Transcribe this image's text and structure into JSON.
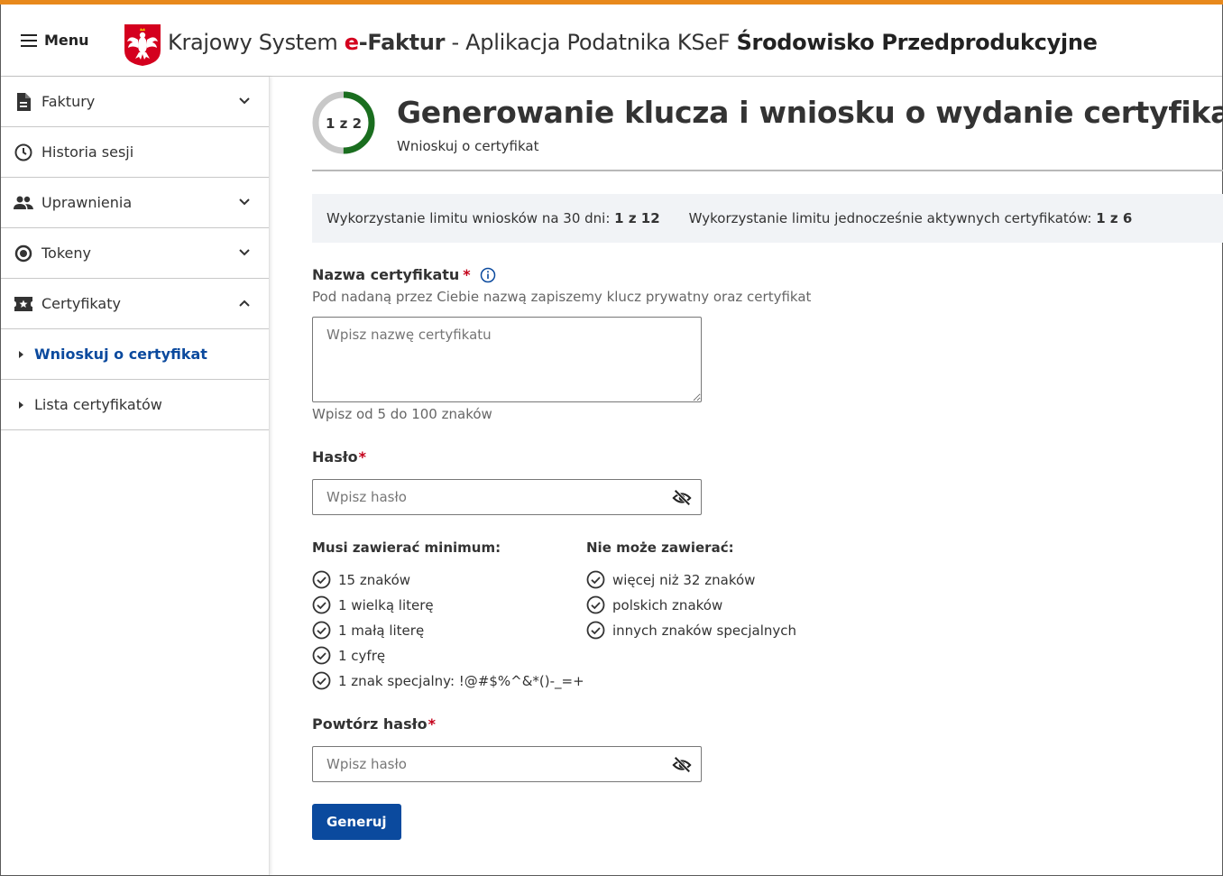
{
  "header": {
    "menu_label": "Menu",
    "title_part1": "Krajowy System ",
    "title_e": "e",
    "title_faktur": "-Faktur",
    "title_part2": " - Aplikacja Podatnika KSeF ",
    "title_env": "Środowisko Przedprodukcyjne",
    "accent_color": "#e8891c"
  },
  "sidebar": {
    "items": [
      {
        "label": "Faktury",
        "icon": "document-icon",
        "expandable": true,
        "expanded": false
      },
      {
        "label": "Historia sesji",
        "icon": "clock-icon",
        "expandable": false
      },
      {
        "label": "Uprawnienia",
        "icon": "people-icon",
        "expandable": true,
        "expanded": false
      },
      {
        "label": "Tokeny",
        "icon": "token-icon",
        "expandable": true,
        "expanded": false
      },
      {
        "label": "Certyfikaty",
        "icon": "certificate-icon",
        "expandable": true,
        "expanded": true
      }
    ],
    "subitems": [
      {
        "label": "Wnioskuj o certyfikat",
        "active": true
      },
      {
        "label": "Lista certyfikatów",
        "active": false
      }
    ]
  },
  "main": {
    "stepper_label": "1 z 2",
    "stepper_progress": 0.5,
    "title": "Generowanie klucza i wniosku o wydanie certyfikatu",
    "subtitle": "Wnioskuj o certyfikat",
    "limits": {
      "requests_label": "Wykorzystanie limitu wniosków na 30 dni: ",
      "requests_value": "1 z 12",
      "active_label": "Wykorzystanie limitu jednocześnie aktywnych certyfikatów: ",
      "active_value": "1 z 6"
    },
    "cert_name": {
      "label": "Nazwa certyfikatu",
      "required_mark": "*",
      "description": "Pod nadaną przez Ciebie nazwą zapiszemy klucz prywatny oraz certyfikat",
      "placeholder": "Wpisz nazwę certyfikatu",
      "value": "",
      "hint": "Wpisz od 5 do 100 znaków"
    },
    "password": {
      "label": "Hasło",
      "required_mark": "*",
      "placeholder": "Wpisz hasło",
      "value": ""
    },
    "rules_must": {
      "heading": "Musi zawierać minimum:",
      "items": [
        "15 znaków",
        "1 wielką literę",
        "1 małą literę",
        "1 cyfrę",
        "1 znak specjalny: !@#$%^&*()-_=+"
      ]
    },
    "rules_cannot": {
      "heading": "Nie może zawierać:",
      "items": [
        "więcej niż 32 znaków",
        "polskich znaków",
        "innych znaków specjalnych"
      ]
    },
    "password_repeat": {
      "label": "Powtórz hasło",
      "required_mark": "*",
      "placeholder": "Wpisz hasło",
      "value": ""
    },
    "generate_button": "Generuj",
    "primary_color": "#0b4a9e",
    "required_color": "#c4001a",
    "progress_color": "#1a6e1f"
  }
}
